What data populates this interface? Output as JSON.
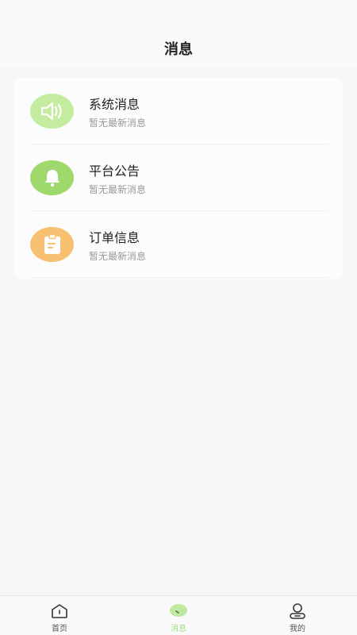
{
  "header": {
    "title": "消息"
  },
  "messages": [
    {
      "title": "系统消息",
      "subtitle": "暂无最新消息",
      "icon": "speaker-icon",
      "color": "#c3ec9f"
    },
    {
      "title": "平台公告",
      "subtitle": "暂无最新消息",
      "icon": "bell-icon",
      "color": "#9fd86d"
    },
    {
      "title": "订单信息",
      "subtitle": "暂无最新消息",
      "icon": "clipboard-icon",
      "color": "#f8c071"
    }
  ],
  "tabbar": {
    "items": [
      {
        "label": "首页",
        "icon": "home-icon",
        "active": false
      },
      {
        "label": "消息",
        "icon": "message-icon",
        "active": true
      },
      {
        "label": "我的",
        "icon": "profile-icon",
        "active": false
      }
    ],
    "active_color": "#a9dc86"
  }
}
